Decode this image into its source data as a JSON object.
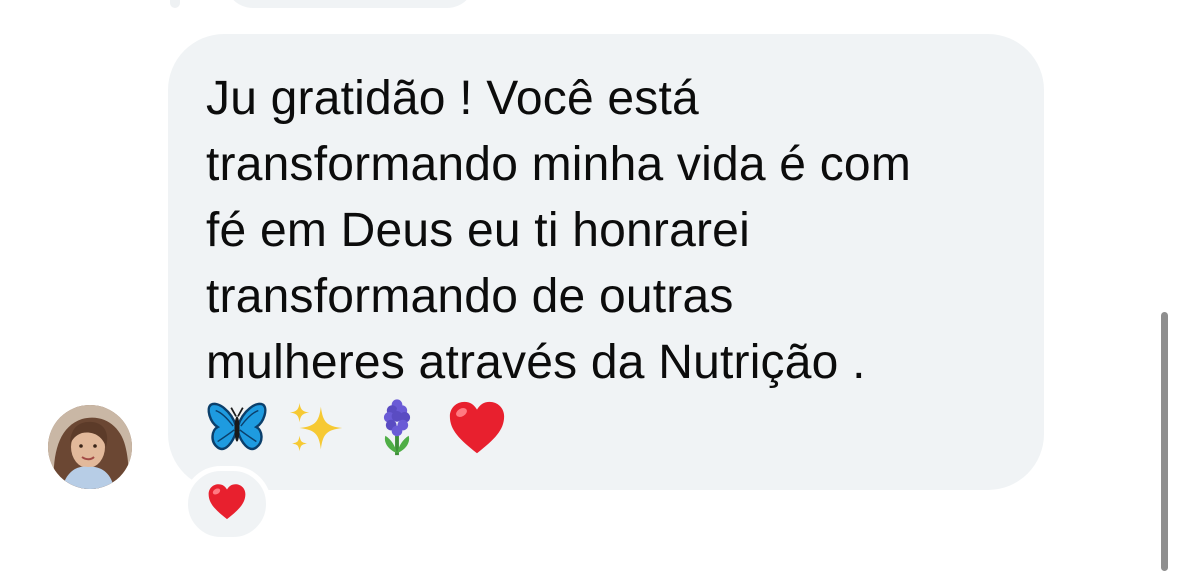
{
  "conversation": {
    "message": {
      "text": "Ju gratidão ! Você está\ntransformando minha vida é com\nfé em Deus eu ti honrarei\ntransformando de outras\nmulheres através da Nutrição .",
      "emojis": [
        "butterfly-icon",
        "sparkles-icon",
        "hyacinth-icon",
        "red-heart-icon"
      ]
    },
    "reaction": {
      "emoji": "red-heart-icon"
    },
    "sender": {
      "avatar": "avatar"
    }
  },
  "colors": {
    "bubble_background": "#f0f3f5",
    "text": "#0c0c0c",
    "heart": "#e8202e",
    "butterfly": "#1e9be0",
    "sparkles": "#f6c933",
    "hyacinth": "#5a4cc2",
    "scrollbar": "#8e8e8e"
  }
}
